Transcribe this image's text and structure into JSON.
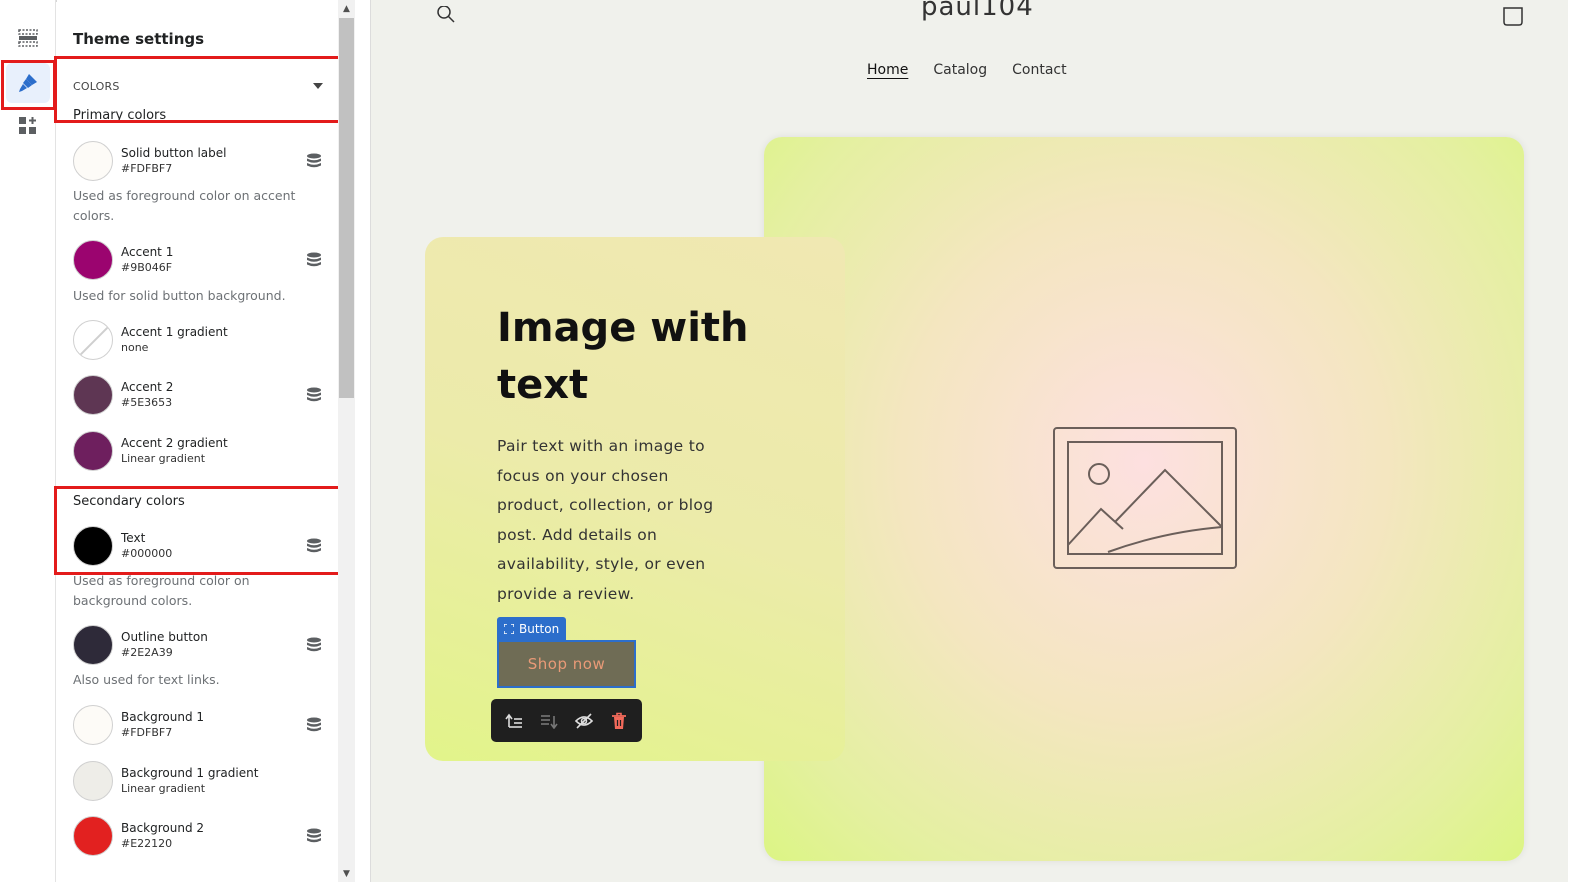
{
  "rail": {
    "items": [
      {
        "name": "sections",
        "icon": "sections-icon"
      },
      {
        "name": "theme-settings",
        "icon": "paint-brush-icon",
        "active": true
      },
      {
        "name": "apps",
        "icon": "apps-icon"
      }
    ]
  },
  "panel": {
    "title": "Theme settings",
    "section_label": "COLORS",
    "primary_title": "Primary colors",
    "secondary_title": "Secondary colors",
    "colors": [
      {
        "name": "Solid button label",
        "value": "#FDFBF7",
        "swatch": "#FDFBF7",
        "help": "Used as foreground color on accent colors."
      },
      {
        "name": "Accent 1",
        "value": "#9B046F",
        "swatch": "#9B046F",
        "help": "Used for solid button background."
      },
      {
        "name": "Accent 1 gradient",
        "value": "none",
        "swatch": "none"
      },
      {
        "name": "Accent 2",
        "value": "#5E3653",
        "swatch": "#5E3653"
      },
      {
        "name": "Accent 2 gradient",
        "value": "Linear gradient",
        "swatch": "#6E1F5E"
      },
      {
        "name": "Text",
        "value": "#000000",
        "swatch": "#000000",
        "help": "Used as foreground color on background colors."
      },
      {
        "name": "Outline button",
        "value": "#2E2A39",
        "swatch": "#2E2A39",
        "help": "Also used for text links."
      },
      {
        "name": "Background 1",
        "value": "#FDFBF7",
        "swatch": "#FDFBF7"
      },
      {
        "name": "Background 1 gradient",
        "value": "Linear gradient",
        "swatch": "#EEEDE8"
      },
      {
        "name": "Background 2",
        "value": "#E22120",
        "swatch": "#E22120"
      }
    ]
  },
  "preview": {
    "store_name": "paul104",
    "nav": [
      "Home",
      "Catalog",
      "Contact"
    ],
    "hero_title": "Image with text",
    "hero_body": "Pair text with an image to focus on your chosen product, collection, or blog post. Add details on availability, style, or even provide a review.",
    "button_tag": "Button",
    "button_label": "Shop now"
  },
  "colors": {
    "highlight": "#E31B1B",
    "editor_blue": "#2C6ECB"
  }
}
